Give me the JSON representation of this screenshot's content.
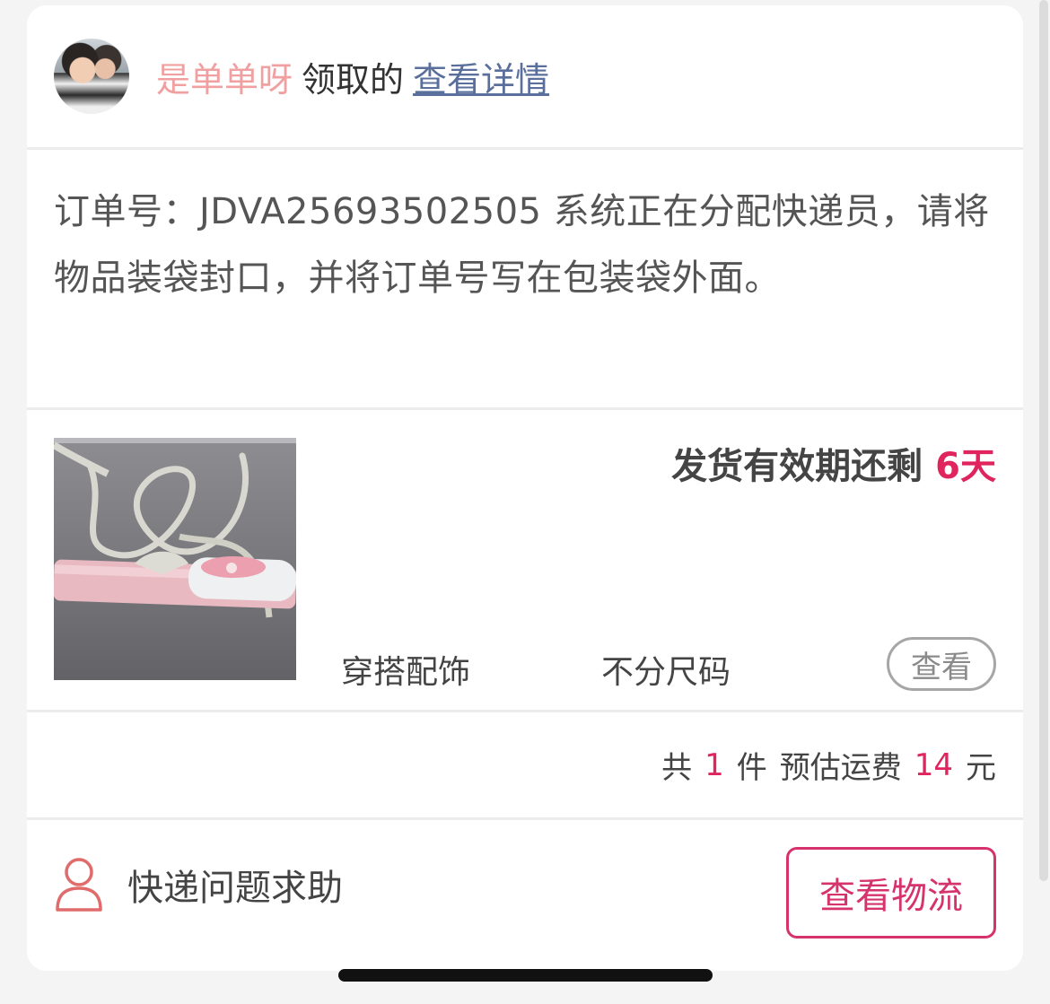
{
  "header": {
    "user_name": "是单单呀",
    "claimed_text": "领取的",
    "details_link": "查看详情"
  },
  "notice": {
    "text": "订单号：JDVA25693502505 系统正在分配快递员，请将物品装袋封口，并将订单号写在包装袋外面。"
  },
  "product": {
    "deadline_label": "发货有效期还剩",
    "deadline_value": "6天",
    "category": "穿搭配饰",
    "size": "不分尺码",
    "view_button": "查看"
  },
  "summary": {
    "prefix": "共",
    "count": "1",
    "count_unit": "件",
    "fee_label": "预估运费",
    "fee_value": "14",
    "fee_unit": "元"
  },
  "footer": {
    "help_label": "快递问题求助",
    "logistics_button": "查看物流"
  },
  "colors": {
    "accent": "#e0245e",
    "username": "#f0a0a0",
    "link": "#5b6f9c"
  },
  "icons": [
    "person-icon"
  ]
}
